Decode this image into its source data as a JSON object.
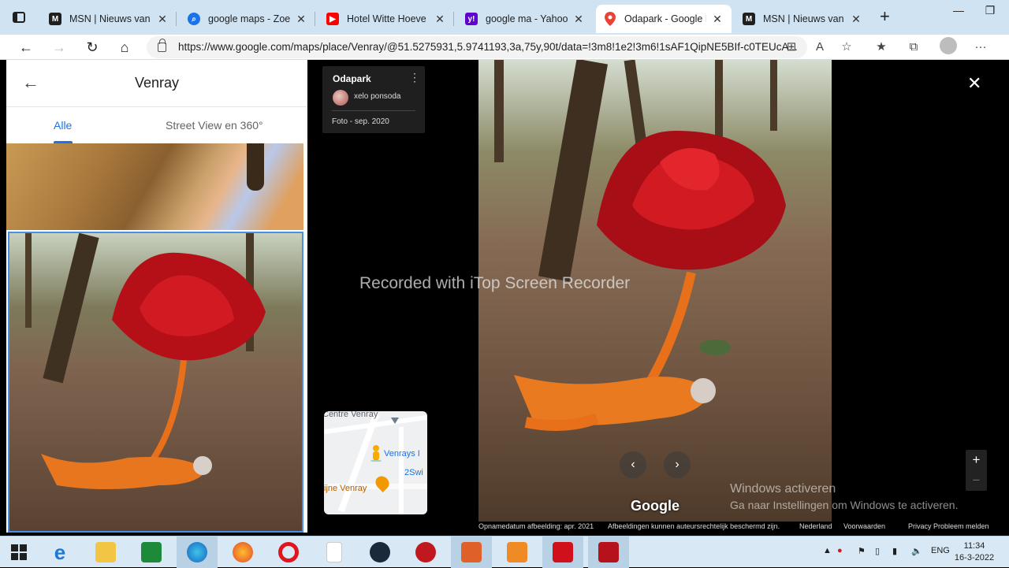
{
  "browser": {
    "tabs": [
      {
        "title": "MSN | Nieuws van de ",
        "favicon": "msn-icon",
        "color": "#1f1f1f"
      },
      {
        "title": "google maps - Zoeken",
        "favicon": "bing-search-icon",
        "color": "#1a73e8"
      },
      {
        "title": "Hotel Witte Hoeve De ",
        "favicon": "youtube-icon",
        "color": "#ff0000"
      },
      {
        "title": "google ma - Yahoo-Zo",
        "favicon": "yahoo-icon",
        "color": "#6001d2"
      },
      {
        "title": "Odapark - Google Map",
        "favicon": "google-maps-icon",
        "color": "#34a853",
        "active": true
      },
      {
        "title": "MSN | Nieuws van de ",
        "favicon": "msn-icon",
        "color": "#1f1f1f"
      }
    ],
    "url": "https://www.google.com/maps/place/Venray/@51.5275931,5.9741193,3a,75y,90t/data=!3m8!1e2!3m6!1sAF1QipNE5BIf-c0TEUcA..."
  },
  "left_panel": {
    "title": "Venray",
    "tabs": [
      {
        "label": "Alle",
        "active": true
      },
      {
        "label": "Street View en 360°",
        "active": false
      }
    ]
  },
  "viewer": {
    "place_name": "Odapark",
    "contributor": "xelo ponsoda",
    "photo_date": "Foto - sep. 2020",
    "watermark": "Recorded with iTop Screen Recorder",
    "google_logo": "Google",
    "activate_line1": "Windows activeren",
    "activate_line2": "Ga naar Instellingen om Windows te activeren.",
    "minimap": {
      "label_top": "Centre Venray",
      "label_venrays": "Venrays I",
      "label_2swi": "2Swi",
      "label_venray": "ijne Venray"
    },
    "footer": {
      "capture_date": "Opnamedatum afbeelding: apr. 2021",
      "copyright": "Afbeeldingen kunnen auteursrechtelijk beschermd zijn.",
      "country": "Nederland",
      "terms": "Voorwaarden",
      "privacy": "Privacy",
      "report": "Probleem melden"
    }
  },
  "taskbar": {
    "language": "ENG",
    "time": "11:34",
    "date": "16-3-2022"
  },
  "colors": {
    "accent": "#1a73e8",
    "tabbar": "#cfe3f3",
    "taskbar": "#d8e8f4"
  }
}
